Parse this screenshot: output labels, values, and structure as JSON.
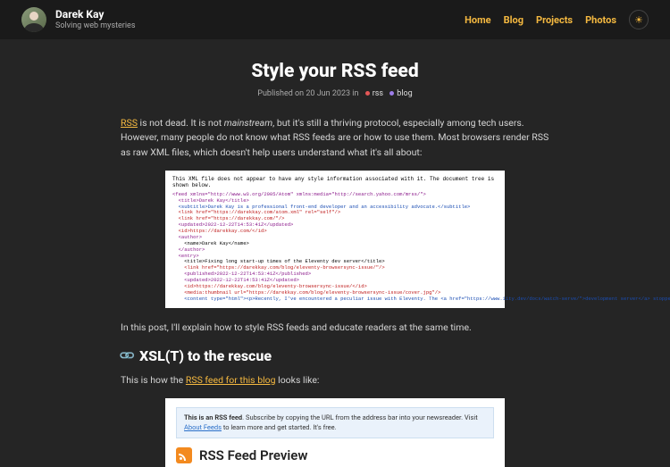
{
  "header": {
    "name": "Darek Kay",
    "tagline": "Solving web mysteries",
    "nav": {
      "home": "Home",
      "blog": "Blog",
      "projects": "Projects",
      "photos": "Photos"
    }
  },
  "post": {
    "title": "Style your RSS feed",
    "meta_prefix": "Published on 20 Jun 2023 in",
    "tag1": "rss",
    "tag2": "blog",
    "intro_rss": "RSS",
    "intro_1a": " is not dead. It is not ",
    "intro_em": "mainstream",
    "intro_1b": ", but it's still a thriving protocol, especially among tech users. However, many people do not know what RSS feeds are or how to use them. Most browsers render RSS as raw XML files, which doesn't help users understand what it's all about:",
    "xml_header": "This XML file does not appear to have any style information associated with it. The document tree is shown below.",
    "intro_2": "In this post, I'll explain how to style RSS feeds and educate readers at the same time.",
    "h2": "XSL(T) to the rescue",
    "p2a": "This is how the ",
    "p2_link": "RSS feed for this blog",
    "p2b": " looks like:",
    "preview": {
      "banner_b": "This is an RSS feed",
      "banner_1": ". Subscribe by copying the URL from the address bar into your newsreader. Visit ",
      "banner_link": "About Feeds",
      "banner_2": " to learn more and get started. It's free.",
      "title": "RSS Feed Preview"
    }
  },
  "xml": {
    "l1": "<feed xmlns=\"http://www.w3.org/2005/Atom\" xmlns:media=\"http://search.yahoo.com/mrss/\">",
    "l2": "  <title>Darek Kay</title>",
    "l3": "  <subtitle>Darek Kay is a professional front-end developer and an accessibility advocate.</subtitle>",
    "l4": "  <link href=\"https://darekkay.com/atom.xml\" rel=\"self\"/>",
    "l5": "  <link href=\"https://darekkay.com/\"/>",
    "l6": "  <updated>2022-12-22T14:53:41Z</updated>",
    "l7": "  <id>https://darekkay.com/</id>",
    "l8": "  <author>",
    "l9": "    <name>Darek Kay</name>",
    "l10": "  </author>",
    "l11": "  <entry>",
    "l12": "    <title>Fixing long start-up times of the Eleventy dev server</title>",
    "l13": "    <link href=\"https://darekkay.com/blog/eleventy-browsersync-issue/\"/>",
    "l14": "    <published>2022-12-22T14:53:41Z</published>",
    "l15": "    <updated>2022-12-22T14:53:41Z</updated>",
    "l16": "    <id>https://darekkay.com/blog/eleventy-browsersync-issue/</id>",
    "l17": "    <media:thumbnail url=\"https://darekkay.com/blog/eleventy-browsersync-issue/cover.jpg\"/>",
    "l18": "    <content type=\"html\"><p>Recently, I've encountered a peculiar issue with Eleventy. The <a href=\"https://www.11ty.dev/docs/watch-serve/\">development server</a> stopped working:</p> <pre"
  }
}
